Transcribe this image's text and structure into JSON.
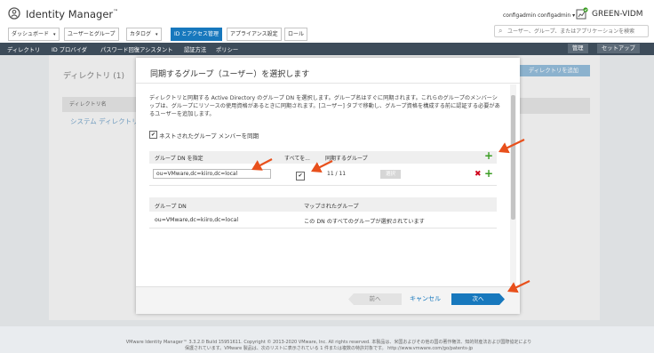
{
  "header": {
    "brand": "Identity Manager",
    "brand_tm": "™",
    "user": "configadmin configadmin ▾",
    "tenant": "GREEN-VIDM"
  },
  "nav": {
    "tabs": [
      {
        "label": "ダッシュボード",
        "caret": "▾"
      },
      {
        "label": "ユーザーとグループ",
        "caret": ""
      },
      {
        "label": "カタログ",
        "caret": "▾"
      },
      {
        "label": "ID とアクセス管理",
        "caret": ""
      },
      {
        "label": "アプライアンス設定",
        "caret": ""
      },
      {
        "label": "ロール",
        "caret": ""
      }
    ],
    "search_placeholder": "ユーザー、グループ、またはアプリケーションを検索"
  },
  "subnav": {
    "items": [
      "ディレクトリ",
      "ID プロバイダ",
      "パスワード回復アシスタント",
      "認証方法",
      "ポリシー"
    ],
    "manage": "管理",
    "setup": "セットアップ"
  },
  "background": {
    "title": "ディレクトリ (1)",
    "add_button": "ディレクトリを追加",
    "table_header": "ディレクトリ名",
    "row": "システム ディレクトリ"
  },
  "modal": {
    "title": "同期するグループ（ユーザー）を選択します",
    "description": "ディレクトリと同期する Active Directory のグループ DN を選択します。グループ名はすぐに同期されます。これらのグループのメンバーシップは、グループにリソースの使用資格があるときに同期されます。[ユーザー] タブで移動し、グループ資格を構成する前に認証する必要があるユーザーを追加します。",
    "nested_checked": "✔",
    "nested_label": "ネストされたグループ メンバーを同期",
    "groups_table": {
      "col_dn": "グループ DN を指定",
      "col_all": "すべてを...",
      "col_sync": "同期するグループ",
      "dn_value": "ou=VMware,dc=kiiro,dc=local",
      "all_checked": "✔",
      "count": "11 / 11",
      "select_button": "選択"
    },
    "mapped_table": {
      "col_dn": "グループ DN",
      "col_mapped": "マップされたグループ",
      "row_dn": "ou=VMware,dc=kiiro,dc=local",
      "row_mapped": "この DN のすべてのグループが選択されています"
    },
    "footer": {
      "prev": "前へ",
      "cancel": "キャンセル",
      "next": "次へ"
    }
  },
  "page_footer": {
    "copyright": "VMware Identity Manager™ 3.3.2.0 Build 15951611. Copyright © 2013-2020 VMware, Inc. All rights reserved. 本製品は、米国およびその他の国の著作権法、知的財産法および国際協定により保護されています。VMware 製品は、次のリストに表示されている 1 件または複数の特許対象です。 http://www.vmware.com/go/patents-jp"
  },
  "colors": {
    "accent": "#1778bd",
    "subnav_bg": "#3d4c5a",
    "add_green": "#3a9d23",
    "delete_red": "#d0021b",
    "annotation_arrow": "#e8501c"
  }
}
